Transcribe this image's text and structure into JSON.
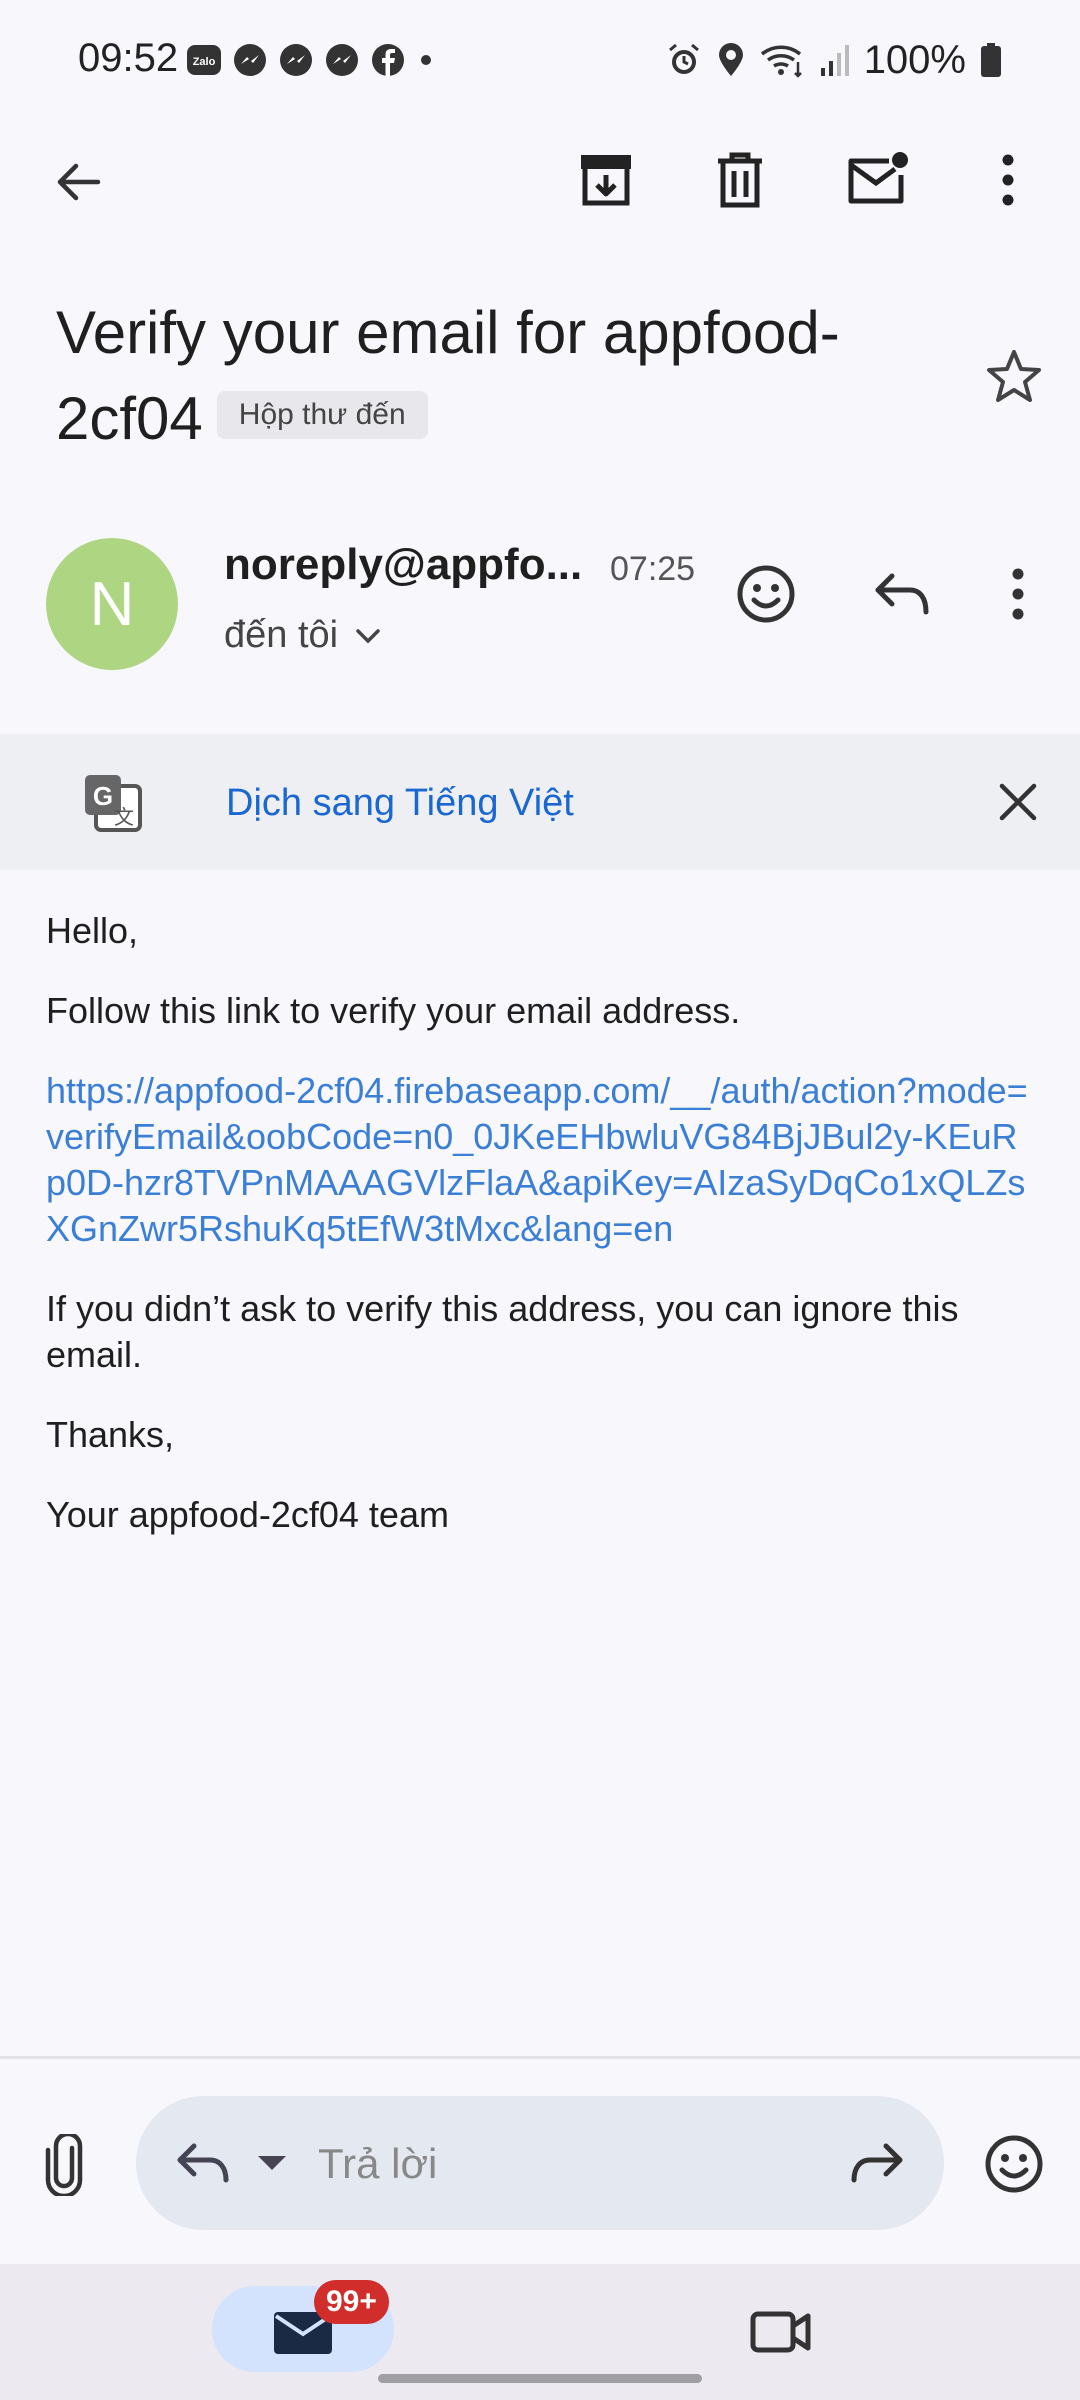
{
  "status_bar": {
    "time": "09:52",
    "battery": "100%",
    "left_icons": [
      "zalo-icon",
      "messenger-icon",
      "messenger-icon",
      "messenger-icon",
      "facebook-icon",
      "dot-icon"
    ],
    "right_icons": [
      "alarm-icon",
      "location-icon",
      "wifi-icon",
      "signal-icon",
      "battery-icon"
    ]
  },
  "app_bar": {
    "icons": [
      "back-arrow-icon",
      "archive-icon",
      "delete-icon",
      "mark-unread-icon",
      "more-vert-icon"
    ]
  },
  "email": {
    "subject": "Verify your email for appfood-2cf04",
    "folder_label": "Hộp thư đến",
    "sender_initial": "N",
    "sender_name": "noreply@appfo...",
    "time": "07:25",
    "recipient": "đến tôi",
    "avatar_color": "#aed581"
  },
  "translate": {
    "label": "Dịch sang Tiếng Việt",
    "color": "#1a67d2"
  },
  "body": {
    "greeting": "Hello,",
    "instruction": "Follow this link to verify your email address.",
    "link": "https://appfood-2cf04.firebaseapp.com/__/auth/action?mode=verifyEmail&oobCode=n0_0JKeEHbwluVG84BjJBul2y-KEuRp0D-hzr8TVPnMAAAGVlzFlaA&apiKey=AIzaSyDqCo1xQLZsXGnZwr5RshuKq5tEfW3tMxc&lang=en",
    "ignore_note": "If you didn’t ask to verify this address, you can ignore this email.",
    "thanks": "Thanks,",
    "signature": "Your appfood-2cf04 team"
  },
  "reply_bar": {
    "placeholder": "Trả lời"
  },
  "bottom_nav": {
    "mail_badge": "99+",
    "badge_color": "#d12d2b"
  }
}
